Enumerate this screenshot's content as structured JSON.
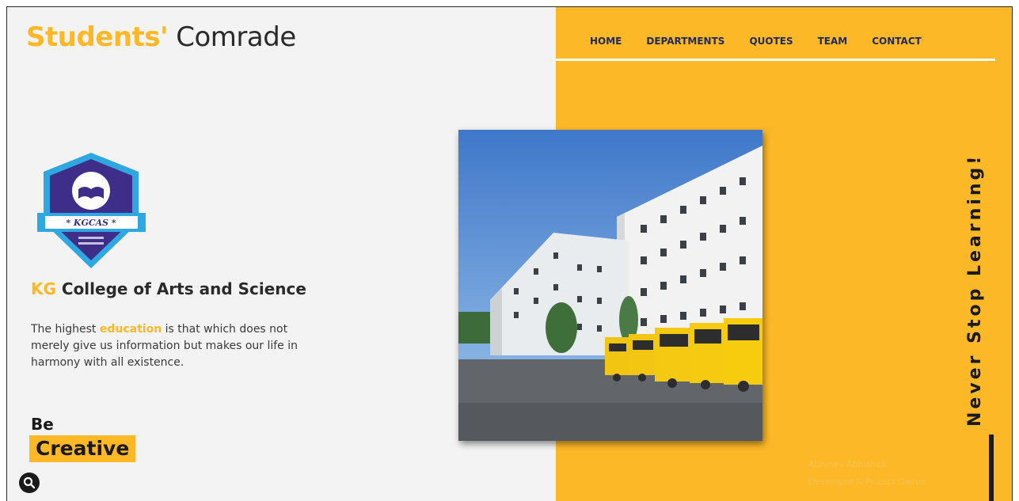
{
  "brand": {
    "part1": "Students'",
    "part2": " Comrade"
  },
  "nav": {
    "home": "HOME",
    "departments": "DEPARTMENTS",
    "quotes": "QUOTES",
    "team": "TEAM",
    "contact": "CONTACT"
  },
  "crest": {
    "text": "KGCAS"
  },
  "college": {
    "prefix": "KG",
    "name": " College of Arts and Science"
  },
  "quote": {
    "before": "The highest ",
    "highlight": "education",
    "after": " is that which does not merely give us information but makes our life in harmony with all existence."
  },
  "tag": {
    "line1": "Be",
    "line2": "Creative"
  },
  "side": {
    "tagline": "Never Stop Learning!"
  },
  "footer": {
    "line1": "Abhinav Abhishek",
    "line2": "Developer & Project Owner"
  },
  "colors": {
    "accent": "#fdb827",
    "dark": "#1a1a1a",
    "navy": "#1f2a5a",
    "crest": "#3f2d8a"
  },
  "icons": {
    "search": "search-icon",
    "crest": "college-crest-logo"
  }
}
